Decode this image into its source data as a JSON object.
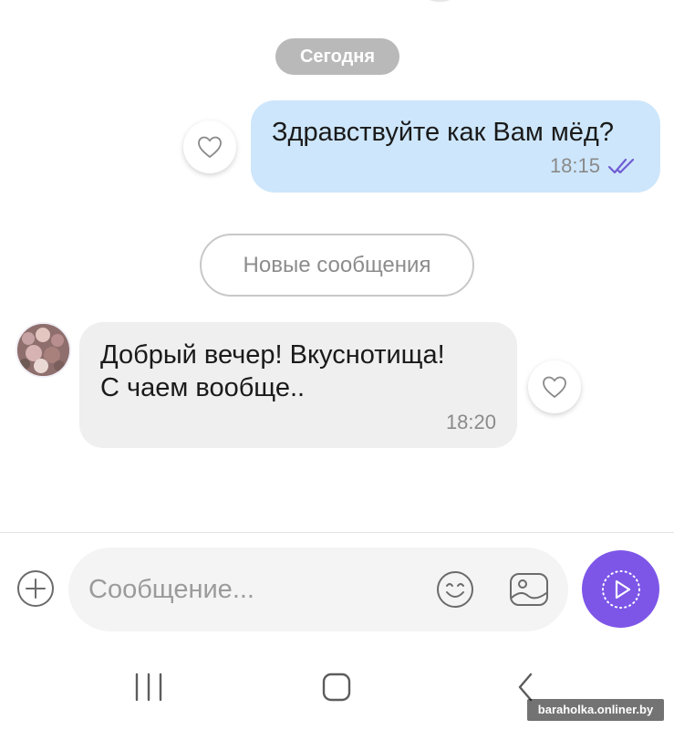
{
  "chat": {
    "date_label": "Сегодня",
    "outgoing": {
      "text": "Здравствуйте как Вам мёд?",
      "time": "18:15",
      "status_icon": "double-check-read-icon",
      "reaction_icon": "heart-outline-icon"
    },
    "new_messages_label": "Новые сообщения",
    "incoming": {
      "line1": "Добрый вечер! Вкуснотища!",
      "line2": "С чаем вообще..",
      "time": "18:20",
      "reaction_icon": "heart-outline-icon"
    }
  },
  "composer": {
    "placeholder": "Сообщение...",
    "value": "",
    "add_icon": "plus-circle-icon",
    "emoji_icon": "smile-icon",
    "gallery_icon": "image-icon",
    "send_icon": "voice-play-icon"
  },
  "nav_bar": {
    "recents_icon": "recents-icon",
    "home_icon": "home-icon",
    "back_icon": "back-chevron-icon"
  },
  "watermark": "baraholka.onliner.by",
  "colors": {
    "outgoing_bubble": "#cde6fb",
    "incoming_bubble": "#efefef",
    "accent": "#7d56e8",
    "read_check": "#6f5dd3",
    "date_pill": "#b9b9b9"
  }
}
